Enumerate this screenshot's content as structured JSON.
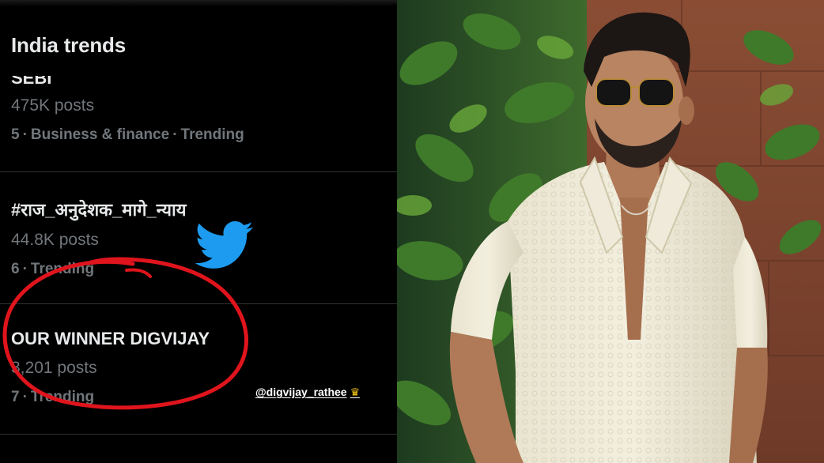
{
  "panel": {
    "title": "India trends",
    "handle": "@digvijay_rathee",
    "crown_icon": "crown-icon"
  },
  "trends": [
    {
      "name": "SEBI",
      "posts": "475K posts",
      "rank": "5",
      "category": "Business & finance",
      "status": "Trending"
    },
    {
      "name": "#राज_अनुदेशक_मागे_न्याय",
      "posts": "44.8K posts",
      "rank": "6",
      "status": "Trending"
    },
    {
      "name": "OUR WINNER DIGVIJAY",
      "posts": "3,201 posts",
      "rank": "7",
      "status": "Trending"
    }
  ],
  "colors": {
    "background": "#000000",
    "text_primary": "#e7e9ea",
    "text_secondary": "#71767b",
    "divider": "#2f3336",
    "twitter_blue": "#1d9bf0",
    "highlight_red": "#e0141c"
  },
  "icons": [
    "twitter-bird-icon",
    "crown-icon"
  ]
}
